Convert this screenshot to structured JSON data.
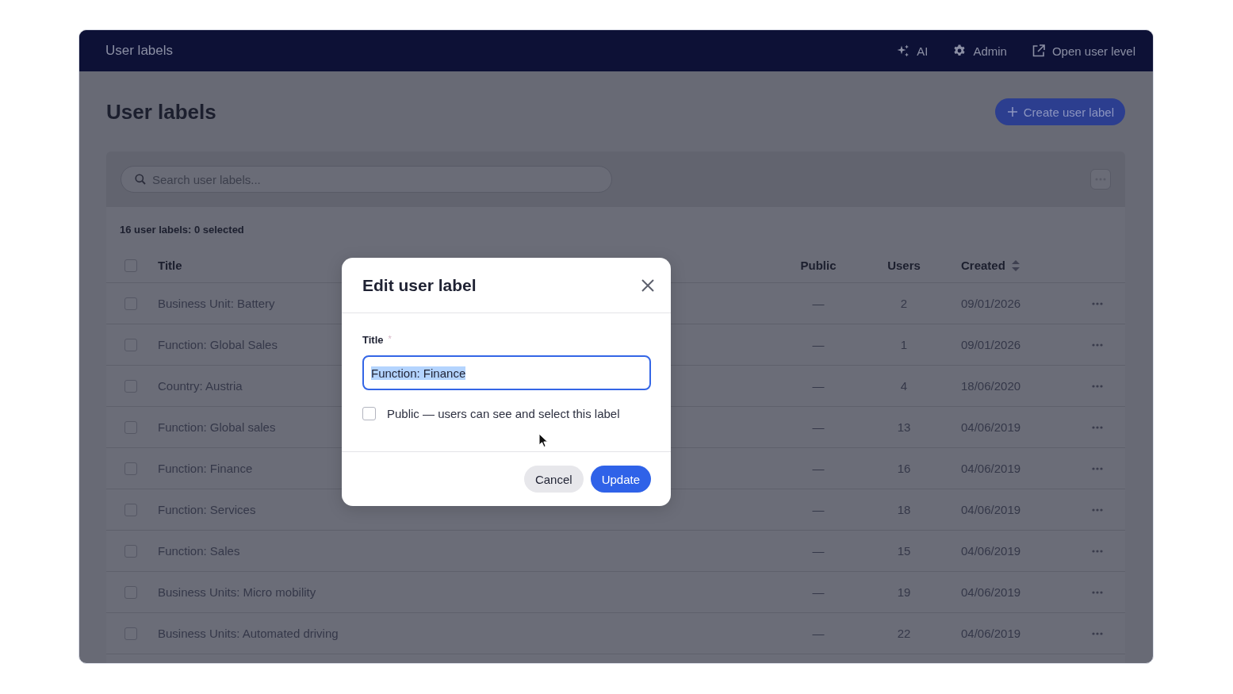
{
  "top_bar": {
    "title": "User labels",
    "items": [
      {
        "kind": "ai",
        "label": "AI"
      },
      {
        "kind": "settings",
        "label": "Admin"
      },
      {
        "kind": "external",
        "label": "Open user level"
      }
    ]
  },
  "page": {
    "title": "User labels",
    "create_button": "Create user label"
  },
  "search": {
    "placeholder": "Search user labels..."
  },
  "table": {
    "summary": "16 user labels: 0 selected",
    "select_all_checked": false,
    "columns": [
      {
        "label": "Title",
        "sortable": false
      },
      {
        "label": "Public",
        "sortable": false
      },
      {
        "label": "Users",
        "sortable": false
      },
      {
        "label": "Created",
        "sortable": true
      }
    ],
    "rows": [
      {
        "checked": false,
        "title": "Business Unit: Battery",
        "public": "—",
        "users": "2",
        "created": "09/01/2026"
      },
      {
        "checked": false,
        "title": "Function: Global Sales",
        "public": "—",
        "users": "1",
        "created": "09/01/2026"
      },
      {
        "checked": false,
        "title": "Country: Austria",
        "public": "—",
        "users": "4",
        "created": "18/06/2020"
      },
      {
        "checked": false,
        "title": "Function: Global sales",
        "public": "—",
        "users": "13",
        "created": "04/06/2019"
      },
      {
        "checked": false,
        "title": "Function: Finance",
        "public": "—",
        "users": "16",
        "created": "04/06/2019"
      },
      {
        "checked": false,
        "title": "Function: Services",
        "public": "—",
        "users": "18",
        "created": "04/06/2019"
      },
      {
        "checked": false,
        "title": "Function: Sales",
        "public": "—",
        "users": "15",
        "created": "04/06/2019"
      },
      {
        "checked": false,
        "title": "Business Units: Micro mobility",
        "public": "—",
        "users": "19",
        "created": "04/06/2019"
      },
      {
        "checked": false,
        "title": "Business Units: Automated driving",
        "public": "—",
        "users": "22",
        "created": "04/06/2019"
      }
    ]
  },
  "dialog": {
    "title": "Edit user label",
    "field_label": "Title",
    "required_mark": "*",
    "value": "Function: Finance",
    "value_selected": true,
    "public_checkbox": {
      "label": "Public — users can see and select this label",
      "checked": false
    },
    "buttons": [
      {
        "kind": "secondary",
        "label": "Cancel"
      },
      {
        "kind": "primary",
        "label": "Update"
      }
    ]
  }
}
